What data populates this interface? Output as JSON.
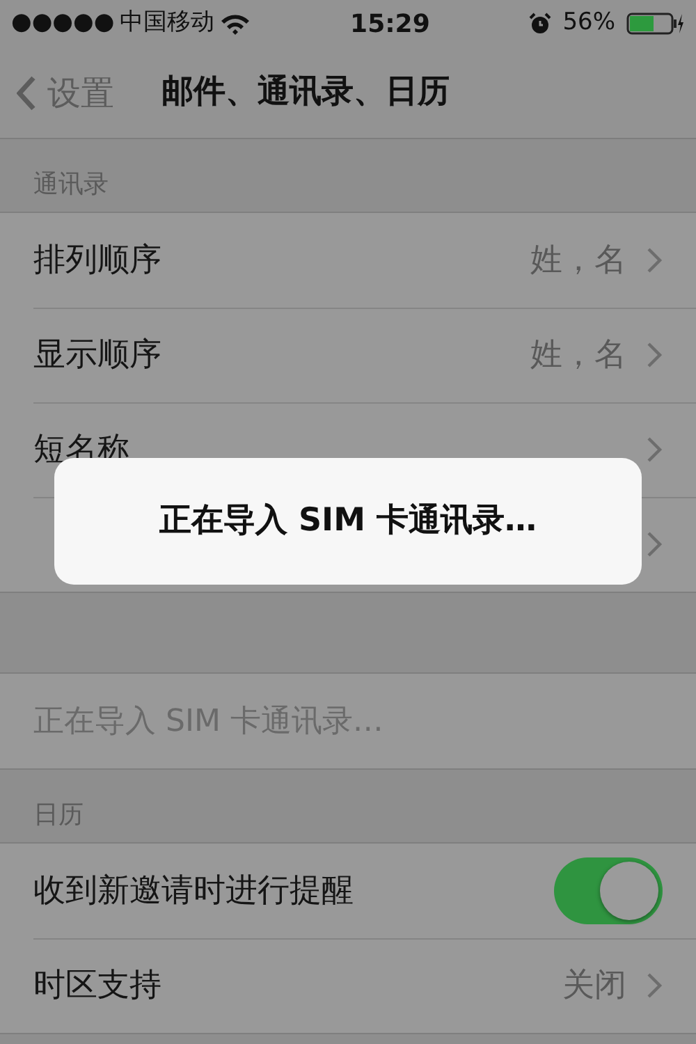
{
  "status_bar": {
    "signal_dots": "●●●●●",
    "carrier": "中国移动",
    "time": "15:29",
    "battery": "56%"
  },
  "nav_bar": {
    "back": "设置",
    "title": "邮件、通讯录、日历"
  },
  "sections": [
    {
      "header": "通讯录",
      "rows": [
        {
          "kind": "link",
          "label": "排列顺序",
          "value": "姓，名"
        },
        {
          "kind": "link",
          "label": "显示顺序",
          "value": "姓，名"
        },
        {
          "kind": "link",
          "label": "短名称"
        },
        {
          "kind": "link"
        }
      ]
    },
    {
      "rows": [
        {
          "kind": "action",
          "label": "正在导入 SIM 卡通讯录…",
          "disabled": true
        }
      ]
    },
    {
      "header": "日历",
      "rows": [
        {
          "kind": "toggle",
          "label": "收到新邀请时进行提醒",
          "on": true
        },
        {
          "kind": "link",
          "label": "时区支持",
          "value": "关闭"
        }
      ]
    }
  ],
  "alert": {
    "message": "正在导入 SIM 卡通讯录…"
  }
}
